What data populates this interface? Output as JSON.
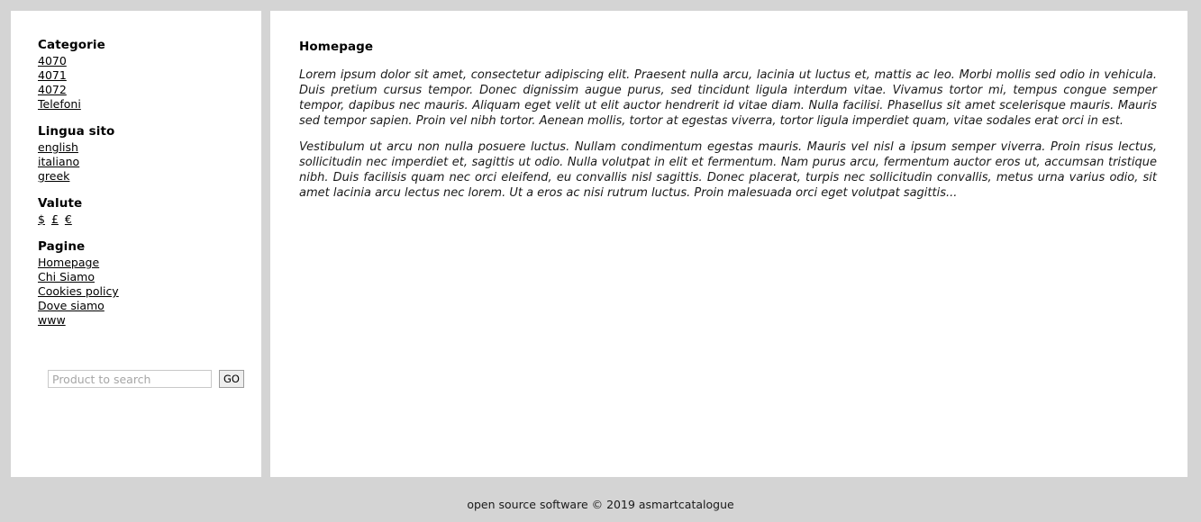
{
  "sidebar": {
    "sections": [
      {
        "title": "Categorie",
        "links": [
          "4070",
          "4071",
          "4072",
          "Telefoni"
        ]
      },
      {
        "title": "Lingua sito",
        "links": [
          "english",
          "italiano",
          "greek"
        ]
      },
      {
        "title": "Valute",
        "links": [
          "$",
          "£",
          "€"
        ]
      },
      {
        "title": "Pagine",
        "links": [
          "Homepage",
          "Chi Siamo",
          "Cookies policy",
          "Dove siamo",
          "www"
        ]
      }
    ],
    "search": {
      "placeholder": "Product to search",
      "value": "",
      "button_label": "GO"
    }
  },
  "main": {
    "title": "Homepage",
    "paragraphs": [
      "Lorem ipsum dolor sit amet, consectetur adipiscing elit. Praesent nulla arcu, lacinia ut luctus et, mattis ac leo. Morbi mollis sed odio in vehicula. Duis pretium cursus tempor. Donec dignissim augue purus, sed tincidunt ligula interdum vitae. Vivamus tortor mi, tempus congue semper tempor, dapibus nec mauris. Aliquam eget velit ut elit auctor hendrerit id vitae diam. Nulla facilisi. Phasellus sit amet scelerisque mauris. Mauris sed tempor sapien. Proin vel nibh tortor. Aenean mollis, tortor at egestas viverra, tortor ligula imperdiet quam, vitae sodales erat orci in est.",
      "Vestibulum ut arcu non nulla posuere luctus. Nullam condimentum egestas mauris. Mauris vel nisl a ipsum semper viverra. Proin risus lectus, sollicitudin nec imperdiet et, sagittis ut odio. Nulla volutpat in elit et fermentum. Nam purus arcu, fermentum auctor eros ut, accumsan tristique nibh. Duis facilisis quam nec orci eleifend, eu convallis nisl sagittis. Donec placerat, turpis nec sollicitudin convallis, metus urna varius odio, sit amet lacinia arcu lectus nec lorem. Ut a eros ac nisi rutrum luctus. Proin malesuada orci eget volutpat sagittis..."
    ]
  },
  "footer": {
    "text": "open source software © 2019 asmartcatalogue"
  },
  "colors": {
    "page_background": "#d4d4d4",
    "panel_background": "#ffffff",
    "text": "#000000",
    "placeholder": "#a6a6a6",
    "button_background": "#eeeeee"
  }
}
